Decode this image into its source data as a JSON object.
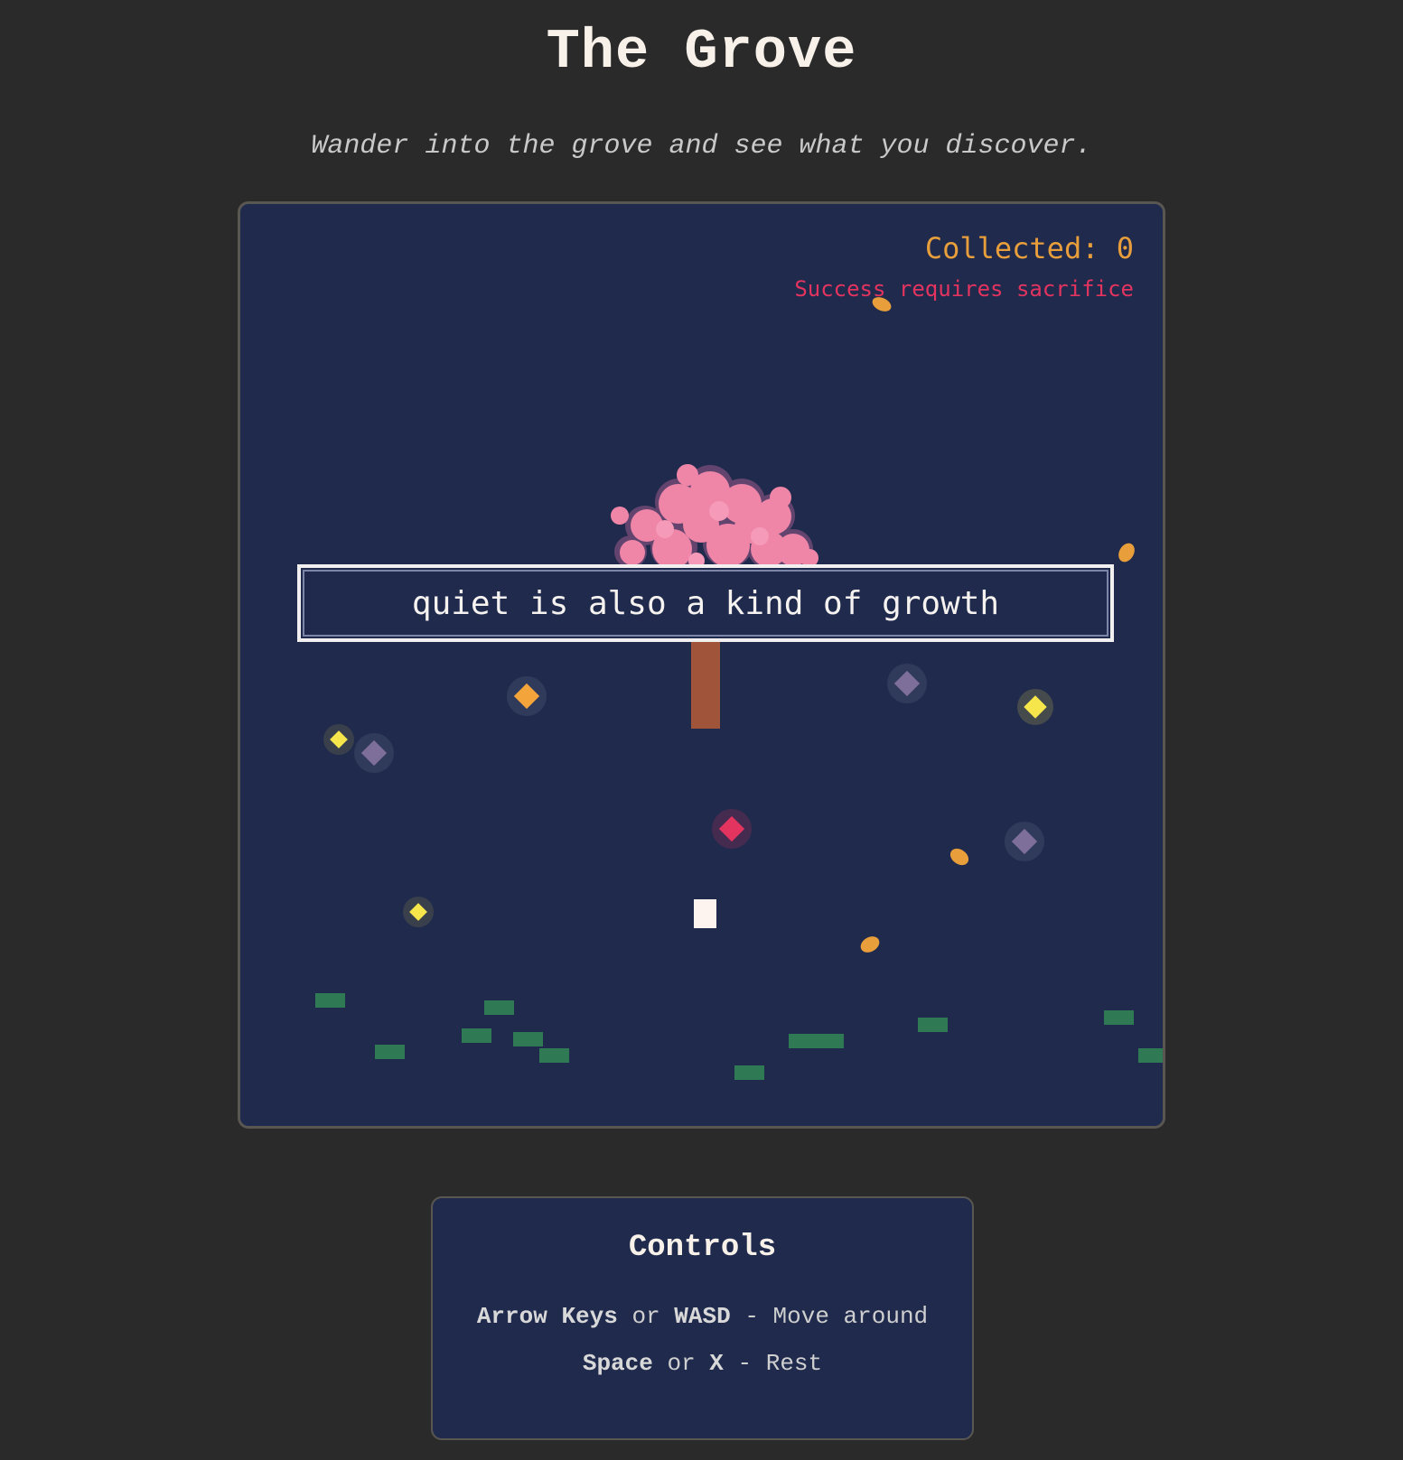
{
  "header": {
    "title": "The Grove",
    "subtitle": "Wander into the grove and see what you discover."
  },
  "hud": {
    "collected_label": "Collected: 0",
    "collected_count": 0,
    "warning": "Success requires sacrifice"
  },
  "message": "quiet is also a kind of growth",
  "controls": {
    "title": "Controls",
    "move_key1": "Arrow Keys",
    "or1": "or",
    "move_key2": "WASD",
    "move_desc": "- Move around",
    "rest_key1": "Space",
    "or2": "or",
    "rest_key2": "X",
    "rest_desc": "- Rest"
  },
  "colors": {
    "background": "#2a2a2a",
    "game_bg": "#1f2a4d",
    "accent_orange": "#e89e3a",
    "warning_red": "#e2345f",
    "blossom_pink": "#ef86a8",
    "trunk_brown": "#a0543a",
    "grass_green": "#2f7a55",
    "gem_yellow": "#f6e64b",
    "gem_purple": "#7e6f9a",
    "gem_red": "#e2345f",
    "player_white": "#fdf3ef"
  },
  "entities": {
    "player": "player-sprite",
    "tree": "blossom-tree",
    "gems": [
      "yellow-gem",
      "purple-gem",
      "orange-gem",
      "red-gem"
    ],
    "leaves": "falling-leaf",
    "grass": "grass-tuft"
  }
}
